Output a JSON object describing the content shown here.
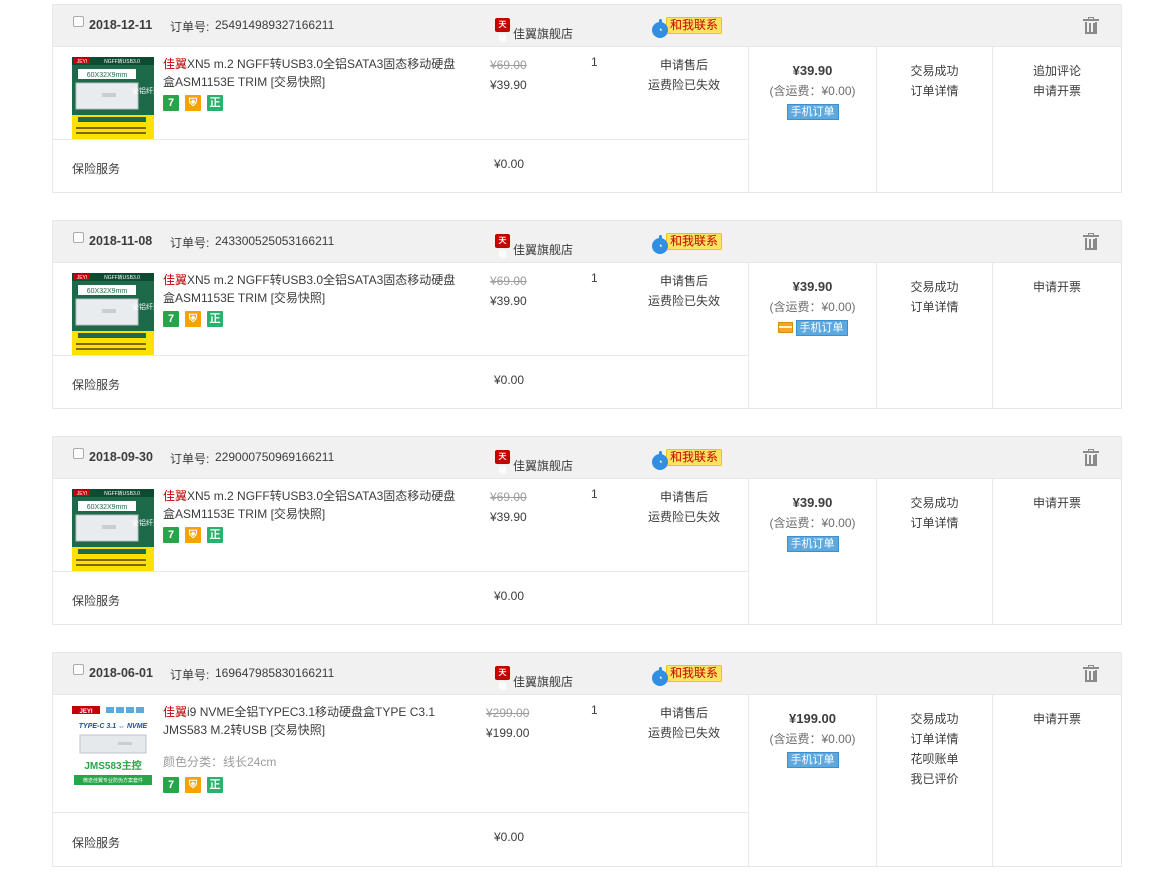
{
  "order_no_label": "订单号:",
  "shop_name": "佳翼旗舰店",
  "tmall_tag": "天猫",
  "contact_label": "和我联系",
  "insurance_label": "保险服务",
  "insurance_price": "¥0.00",
  "after_sale": "申请售后",
  "ship_ins": "运费险已失效",
  "mobile_order": "手机订单",
  "badge_7": "7",
  "badge_zheng": "正",
  "orders": [
    {
      "date": "2018-12-11",
      "order_no": "254914989327166211",
      "brand": "佳翼",
      "title": "XN5 m.2 NGFF转USB3.0全铝SATA3固态移动硬盘盒ASM1153E TRIM [交易快照]",
      "orig_price": "¥69.00",
      "price": "¥39.90",
      "qty": "1",
      "total": "¥39.90",
      "ship": "(含运费：¥0.00)",
      "status": [
        "交易成功",
        "订单详情"
      ],
      "ops": [
        "追加评论",
        "申请开票"
      ],
      "thumb": {
        "brand": "JEYI",
        "line1": "NGFF转USB3.0",
        "size": "60X32X9mm",
        "side": "全铝纤薄"
      }
    },
    {
      "date": "2018-11-08",
      "order_no": "243300525053166211",
      "brand": "佳翼",
      "title": "XN5 m.2 NGFF转USB3.0全铝SATA3固态移动硬盘盒ASM1153E TRIM [交易快照]",
      "orig_price": "¥69.00",
      "price": "¥39.90",
      "qty": "1",
      "total": "¥39.90",
      "ship": "(含运费：¥0.00)",
      "status": [
        "交易成功",
        "订单详情"
      ],
      "ops": [
        "申请开票"
      ],
      "thumb": {
        "brand": "JEYI",
        "line1": "NGFF转USB3.0",
        "size": "60X32X9mm",
        "side": "全铝纤薄"
      }
    },
    {
      "date": "2018-09-30",
      "order_no": "229000750969166211",
      "brand": "佳翼",
      "title": "XN5 m.2 NGFF转USB3.0全铝SATA3固态移动硬盘盒ASM1153E TRIM [交易快照]",
      "orig_price": "¥69.00",
      "price": "¥39.90",
      "qty": "1",
      "total": "¥39.90",
      "ship": "(含运费：¥0.00)",
      "status": [
        "交易成功",
        "订单详情"
      ],
      "ops": [
        "申请开票"
      ],
      "thumb": {
        "brand": "JEYI",
        "line1": "NGFF转USB3.0",
        "size": "60X32X9mm",
        "side": "全铝纤薄"
      }
    },
    {
      "date": "2018-06-01",
      "order_no": "169647985830166211",
      "brand": "佳翼",
      "title": "i9 NVME全铝TYPEC3.1移动硬盘盒TYPE C3.1 JMS583 M.2转USB [交易快照]",
      "sku": "颜色分类：线长24cm",
      "orig_price": "¥299.00",
      "price": "¥199.00",
      "qty": "1",
      "total": "¥199.00",
      "ship": "(含运费：¥0.00)",
      "status": [
        "交易成功",
        "订单详情",
        "花呗账单",
        "我已评价"
      ],
      "ops": [
        "申请开票"
      ],
      "thumb": {
        "brand": "JEYI",
        "line1": "TYPE-C 3.1 ⇔ NVME",
        "chip": "JMS583主控",
        "footer": "微迭佳翼专业防伪方案套件"
      }
    }
  ]
}
